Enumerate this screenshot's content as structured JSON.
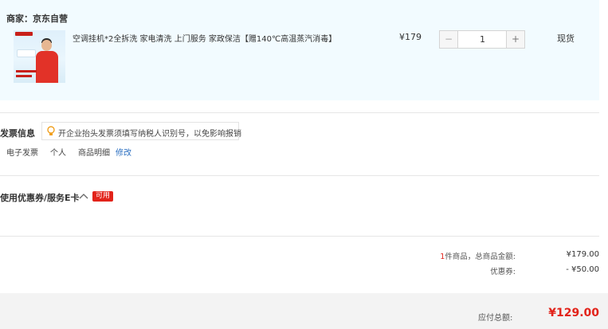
{
  "shop": {
    "label": "商家：京东自营",
    "item": {
      "thumbnail_icon": "product-thumbnail",
      "title": "空调挂机*2全拆洗 家电清洗 上门服务 家政保洁【赠140℃高温蒸汽消毒】",
      "price": "¥179",
      "quantity": "1",
      "minus_label": "−",
      "plus_label": "+",
      "stock_status": "现货"
    }
  },
  "invoice": {
    "title": "发票信息",
    "tip_icon": "lightbulb-icon",
    "tip_text": "开企业抬头发票须填写纳税人识别号，以免影响报销",
    "type": "电子发票",
    "holder": "个人",
    "content": "商品明细",
    "edit_label": "修改"
  },
  "coupon": {
    "title": "使用优惠券/服务E卡",
    "toggle_icon": "chevron-up-icon",
    "badge": "可用"
  },
  "summary": {
    "item_count": "1",
    "item_count_suffix": "件商品，总商品金额:",
    "goods_total": "¥179.00",
    "coupon_label": "优惠券:",
    "coupon_value": "- ¥50.00",
    "payable_label": "应付总额:",
    "payable_total": "¥129.00"
  },
  "colors": {
    "accent_red": "#e2231a",
    "link_blue": "#2b6fc1",
    "shop_bg": "#f2fbff"
  }
}
